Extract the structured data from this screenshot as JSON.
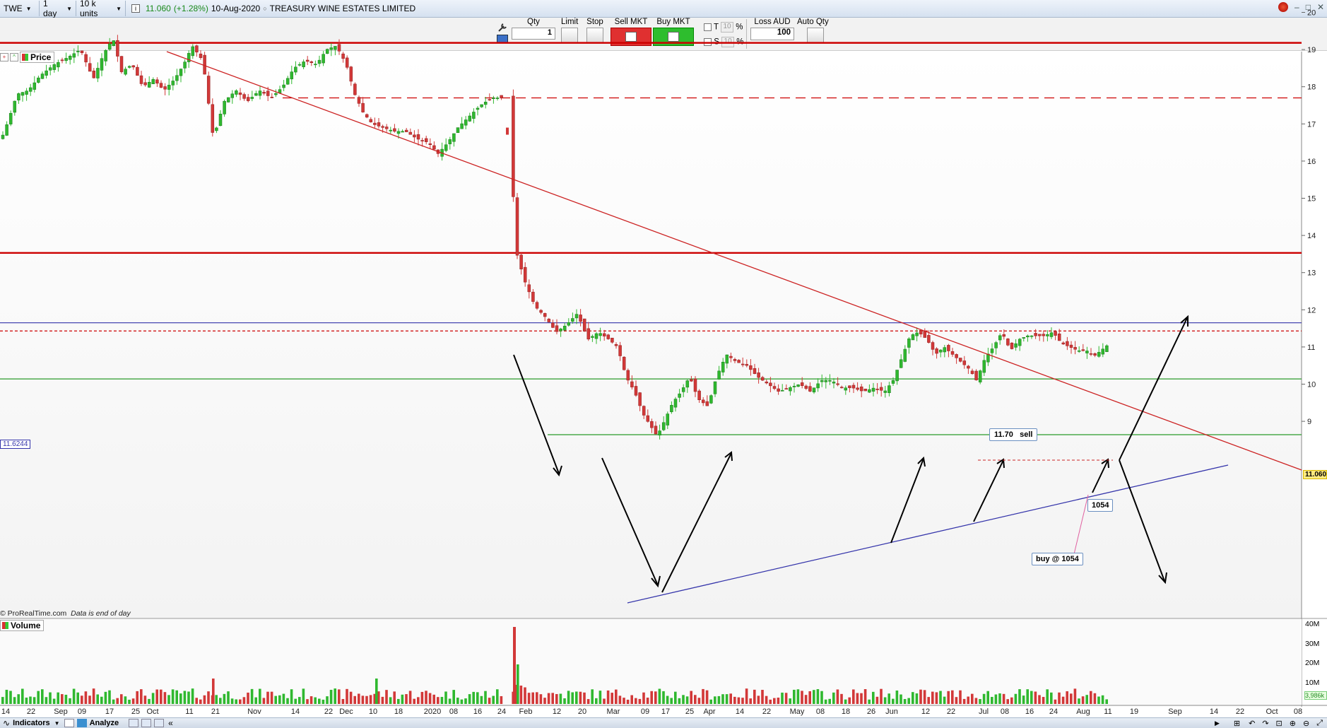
{
  "topbar": {
    "symbol": "TWE",
    "interval": "1 day",
    "units": "10 k units",
    "info_icon": "i",
    "price": "11.060",
    "change": "(+1.28%)",
    "date": "10-Aug-2020",
    "instrument": "TREASURY WINE ESTATES LIMITED",
    "window_controls": [
      "–",
      "□",
      "✕"
    ]
  },
  "orderbar": {
    "qty_label": "Qty",
    "qty_value": "1",
    "limit_label": "Limit",
    "stop_label": "Stop",
    "sell_label": "Sell MKT",
    "buy_label": "Buy MKT",
    "t_label": "T",
    "s_label": "S",
    "pct_value_t": "10",
    "pct_value_s": "10",
    "pct_sign": "%",
    "loss_label": "Loss AUD",
    "loss_value": "100",
    "autoqty_label": "Auto Qty"
  },
  "price_panel": {
    "label": "Price",
    "left_marker": "11.6244",
    "current_price_tag": "11.060",
    "footer": "© ProRealTime.com",
    "footer_note": "Data is end of day",
    "callouts": {
      "sell": "11.70   sell",
      "level": "1054",
      "buy": "buy @ 1054"
    }
  },
  "volume_panel": {
    "label": "Volume",
    "y_ticks": [
      "40M",
      "30M",
      "20M",
      "10M"
    ],
    "current_tag": "3,986k"
  },
  "x_axis": {
    "labels": [
      "14",
      "22",
      "Sep",
      "09",
      "17",
      "25",
      "Oct",
      "11",
      "21",
      "Nov",
      "14",
      "22",
      "Dec",
      "10",
      "18",
      "2020",
      "08",
      "16",
      "24",
      "Feb",
      "12",
      "20",
      "Mar",
      "09",
      "17",
      "25",
      "Apr",
      "14",
      "22",
      "May",
      "08",
      "18",
      "26",
      "Jun",
      "12",
      "22",
      "Jul",
      "08",
      "16",
      "24",
      "Aug",
      "11",
      "19",
      "Sep",
      "14",
      "22",
      "Oct",
      "08"
    ]
  },
  "bottombar": {
    "indicators": "Indicators",
    "analyze": "Analyze"
  },
  "chart_data": {
    "type": "candlestick",
    "instrument": "TREASURY WINE ESTATES LIMITED",
    "y_ticks": [
      9,
      10,
      11,
      12,
      13,
      14,
      15,
      16,
      17,
      18,
      19,
      20
    ],
    "ylim": [
      8.2,
      20.6
    ],
    "horizontal_levels": [
      {
        "value": 19.18,
        "color": "#cc0000",
        "style": "solid"
      },
      {
        "value": 17.7,
        "color": "#cc0000",
        "style": "dashed"
      },
      {
        "value": 13.53,
        "color": "#cc0000",
        "style": "solid"
      },
      {
        "value": 11.65,
        "color": "#3333aa",
        "style": "solid"
      },
      {
        "value": 11.43,
        "color": "#cc0000",
        "style": "dashed"
      },
      {
        "value": 10.14,
        "color": "#2a9a2a",
        "style": "solid"
      },
      {
        "value": 8.64,
        "color": "#2a9a2a",
        "style": "solid"
      }
    ],
    "price_path": [
      {
        "x": 0,
        "y": 16.6
      },
      {
        "x": 10,
        "y": 17.1
      },
      {
        "x": 22,
        "y": 17.8
      },
      {
        "x": 38,
        "y": 17.9
      },
      {
        "x": 55,
        "y": 18.3
      },
      {
        "x": 75,
        "y": 18.6
      },
      {
        "x": 95,
        "y": 18.8
      },
      {
        "x": 112,
        "y": 19.0
      },
      {
        "x": 130,
        "y": 18.2
      },
      {
        "x": 145,
        "y": 18.9
      },
      {
        "x": 158,
        "y": 19.3
      },
      {
        "x": 170,
        "y": 18.4
      },
      {
        "x": 185,
        "y": 18.6
      },
      {
        "x": 200,
        "y": 18.0
      },
      {
        "x": 215,
        "y": 18.2
      },
      {
        "x": 230,
        "y": 17.9
      },
      {
        "x": 245,
        "y": 18.2
      },
      {
        "x": 258,
        "y": 18.6
      },
      {
        "x": 270,
        "y": 19.1
      },
      {
        "x": 285,
        "y": 18.7
      },
      {
        "x": 300,
        "y": 16.6
      },
      {
        "x": 315,
        "y": 17.6
      },
      {
        "x": 332,
        "y": 17.9
      },
      {
        "x": 348,
        "y": 17.6
      },
      {
        "x": 365,
        "y": 17.9
      },
      {
        "x": 382,
        "y": 17.7
      },
      {
        "x": 398,
        "y": 18.0
      },
      {
        "x": 414,
        "y": 18.5
      },
      {
        "x": 430,
        "y": 18.7
      },
      {
        "x": 446,
        "y": 18.6
      },
      {
        "x": 460,
        "y": 19.0
      },
      {
        "x": 474,
        "y": 19.1
      },
      {
        "x": 488,
        "y": 18.6
      },
      {
        "x": 500,
        "y": 17.8
      },
      {
        "x": 512,
        "y": 17.3
      },
      {
        "x": 525,
        "y": 17.0
      },
      {
        "x": 540,
        "y": 16.9
      },
      {
        "x": 556,
        "y": 16.8
      },
      {
        "x": 572,
        "y": 16.8
      },
      {
        "x": 588,
        "y": 16.6
      },
      {
        "x": 604,
        "y": 16.5
      },
      {
        "x": 618,
        "y": 16.2
      },
      {
        "x": 632,
        "y": 16.5
      },
      {
        "x": 646,
        "y": 16.9
      },
      {
        "x": 662,
        "y": 17.2
      },
      {
        "x": 678,
        "y": 17.5
      },
      {
        "x": 694,
        "y": 17.7
      },
      {
        "x": 708,
        "y": 17.7
      },
      {
        "x": 720,
        "y": 16.8
      },
      {
        "x": 728,
        "y": 13.6
      },
      {
        "x": 740,
        "y": 12.8
      },
      {
        "x": 755,
        "y": 12.1
      },
      {
        "x": 770,
        "y": 11.8
      },
      {
        "x": 785,
        "y": 11.4
      },
      {
        "x": 800,
        "y": 11.6
      },
      {
        "x": 815,
        "y": 11.9
      },
      {
        "x": 830,
        "y": 11.2
      },
      {
        "x": 845,
        "y": 11.4
      },
      {
        "x": 860,
        "y": 11.2
      },
      {
        "x": 872,
        "y": 11.0
      },
      {
        "x": 884,
        "y": 10.2
      },
      {
        "x": 896,
        "y": 9.8
      },
      {
        "x": 908,
        "y": 9.2
      },
      {
        "x": 918,
        "y": 8.9
      },
      {
        "x": 928,
        "y": 8.6
      },
      {
        "x": 938,
        "y": 9.0
      },
      {
        "x": 950,
        "y": 9.5
      },
      {
        "x": 962,
        "y": 9.8
      },
      {
        "x": 974,
        "y": 10.2
      },
      {
        "x": 986,
        "y": 9.6
      },
      {
        "x": 1000,
        "y": 9.4
      },
      {
        "x": 1012,
        "y": 10.2
      },
      {
        "x": 1026,
        "y": 10.8
      },
      {
        "x": 1040,
        "y": 10.6
      },
      {
        "x": 1055,
        "y": 10.5
      },
      {
        "x": 1070,
        "y": 10.2
      },
      {
        "x": 1085,
        "y": 10.0
      },
      {
        "x": 1100,
        "y": 9.8
      },
      {
        "x": 1115,
        "y": 9.9
      },
      {
        "x": 1130,
        "y": 10.0
      },
      {
        "x": 1145,
        "y": 9.8
      },
      {
        "x": 1160,
        "y": 10.1
      },
      {
        "x": 1175,
        "y": 10.1
      },
      {
        "x": 1190,
        "y": 9.9
      },
      {
        "x": 1205,
        "y": 9.9
      },
      {
        "x": 1220,
        "y": 9.8
      },
      {
        "x": 1235,
        "y": 9.9
      },
      {
        "x": 1250,
        "y": 9.8
      },
      {
        "x": 1262,
        "y": 10.1
      },
      {
        "x": 1274,
        "y": 10.7
      },
      {
        "x": 1286,
        "y": 11.3
      },
      {
        "x": 1298,
        "y": 11.4
      },
      {
        "x": 1310,
        "y": 11.2
      },
      {
        "x": 1322,
        "y": 10.8
      },
      {
        "x": 1334,
        "y": 11.0
      },
      {
        "x": 1346,
        "y": 10.8
      },
      {
        "x": 1358,
        "y": 10.6
      },
      {
        "x": 1370,
        "y": 10.4
      },
      {
        "x": 1380,
        "y": 10.1
      },
      {
        "x": 1392,
        "y": 10.7
      },
      {
        "x": 1404,
        "y": 11.0
      },
      {
        "x": 1416,
        "y": 11.4
      },
      {
        "x": 1428,
        "y": 10.9
      },
      {
        "x": 1440,
        "y": 11.2
      },
      {
        "x": 1452,
        "y": 11.3
      },
      {
        "x": 1464,
        "y": 11.3
      },
      {
        "x": 1476,
        "y": 11.3
      },
      {
        "x": 1488,
        "y": 11.4
      },
      {
        "x": 1500,
        "y": 11.1
      },
      {
        "x": 1512,
        "y": 11.0
      },
      {
        "x": 1524,
        "y": 10.9
      },
      {
        "x": 1536,
        "y": 10.9
      },
      {
        "x": 1546,
        "y": 10.75
      },
      {
        "x": 1556,
        "y": 10.9
      },
      {
        "x": 1566,
        "y": 11.06
      }
    ],
    "volume_panel_ylim": [
      0,
      40
    ],
    "volume_spike_x": 726
  }
}
